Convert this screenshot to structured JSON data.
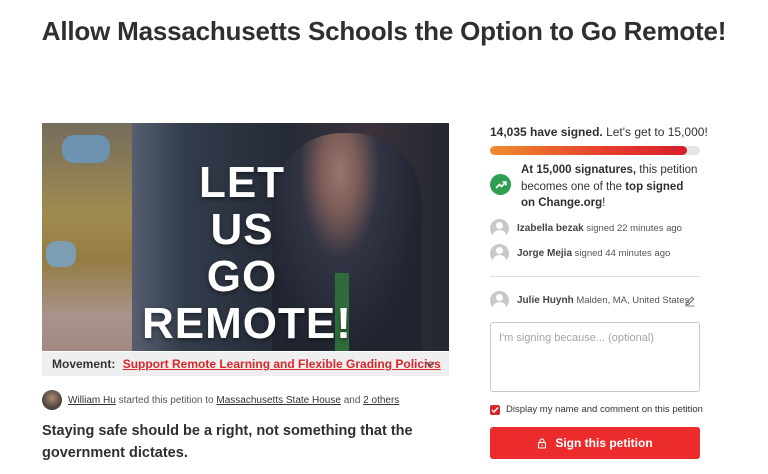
{
  "petition": {
    "title": "Allow Massachusetts Schools the Option to Go Remote!",
    "image_slogan": [
      "LET",
      "US",
      "GO",
      "REMOTE!"
    ],
    "movement_label": "Movement:",
    "movement_link": "Support Remote Learning and Flexible Grading Policies",
    "starter_name": "William Hu",
    "starter_mid": "started this petition to",
    "target": "Massachusetts State House",
    "and_text": "and",
    "others": "2 others",
    "lede": "Staying safe should be a right, not something that the government dictates."
  },
  "signatures": {
    "count_text": "14,035 have signed.",
    "goal_text": "Let's get to 15,000!",
    "progress_fraction": 0.936,
    "milestone_intro": "At 15,000 signatures,",
    "milestone_mid": " this petition becomes one of the ",
    "milestone_bold": "top signed on Change.org",
    "milestone_end": "!"
  },
  "recent_signers": [
    {
      "name": "Izabella bezak",
      "time": "signed 22 minutes ago"
    },
    {
      "name": "Jorge Mejia",
      "time": "signed 44 minutes ago"
    }
  ],
  "signer_form": {
    "name": "Julie Huynh",
    "location": "Malden, MA, United States",
    "comment_placeholder": "I'm signing because... (optional)",
    "display_label": "Display my name and comment on this petition",
    "sign_button": "Sign this petition"
  },
  "colors": {
    "accent": "#ec2c2c",
    "link_red": "#d9262c",
    "milestone_green": "#2f9e52"
  },
  "icons": [
    "chevron-down-icon",
    "trend-up-icon",
    "user-icon",
    "edit-icon",
    "check-icon",
    "lock-icon"
  ]
}
